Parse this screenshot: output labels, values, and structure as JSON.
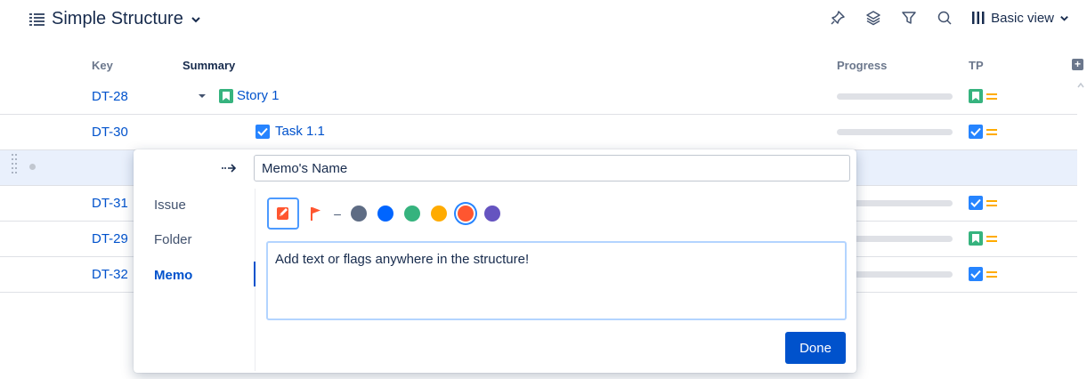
{
  "header": {
    "title": "Simple Structure",
    "view_label": "Basic view",
    "icons": [
      "pin-icon",
      "layers-icon",
      "filter-icon",
      "search-icon",
      "columns-icon"
    ]
  },
  "columns": {
    "key": "Key",
    "summary": "Summary",
    "progress": "Progress",
    "tp": "TP"
  },
  "rows": [
    {
      "key": "DT-28",
      "summary": "Story 1",
      "type": "story"
    },
    {
      "key": "DT-30",
      "summary": "Task 1.1",
      "type": "task"
    },
    {
      "key": "",
      "summary": "",
      "type": "new-row"
    },
    {
      "key": "DT-31",
      "summary": "",
      "type": "task"
    },
    {
      "key": "DT-29",
      "summary": "",
      "type": "story"
    },
    {
      "key": "DT-32",
      "summary": "",
      "type": "task"
    }
  ],
  "popup": {
    "name_value": "Memo's Name",
    "tabs": [
      "Issue",
      "Folder",
      "Memo"
    ],
    "active_tab": "Memo",
    "text_value": "Add text or flags anywhere in the structure!",
    "done_label": "Done",
    "dash": "–",
    "colors": [
      "#5e6c84",
      "#0065ff",
      "#36b37e",
      "#ffab00",
      "#ff5630",
      "#6554c0"
    ],
    "selected_color": "#ff5630"
  },
  "colors": {
    "accent": "#0052cc",
    "story": "#36b37e",
    "task": "#2684ff",
    "tp_lines": "#ffab00"
  }
}
